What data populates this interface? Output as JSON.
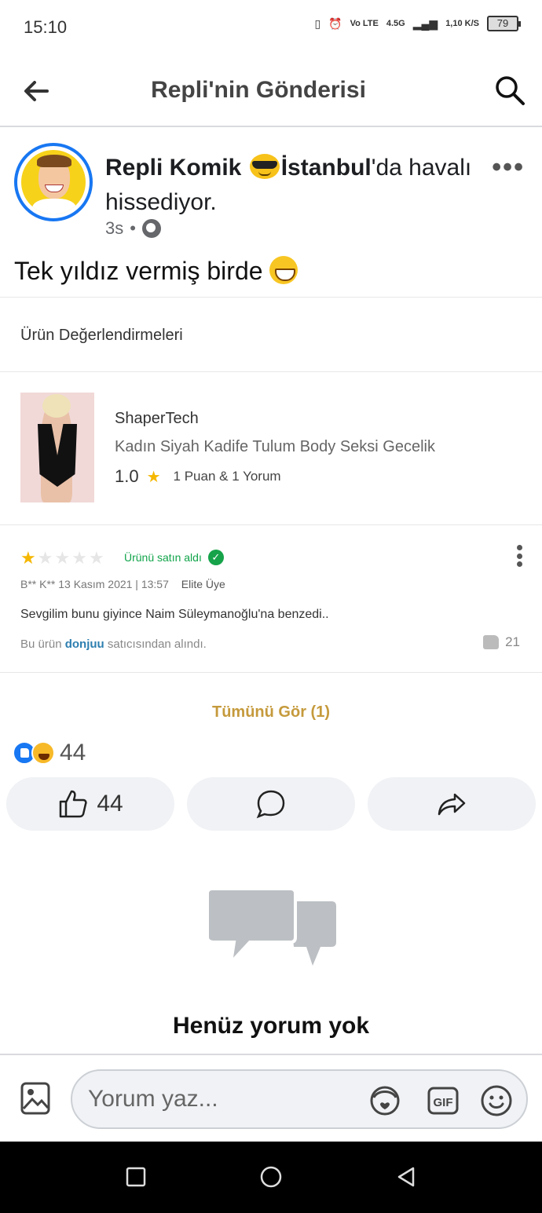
{
  "status_bar": {
    "time": "15:10",
    "network": "4.5G",
    "volte": "Vo LTE",
    "speed": "1,10 K/S",
    "battery": "79"
  },
  "header": {
    "title": "Repli'nin Gönderisi"
  },
  "post": {
    "author": "Repli Komik",
    "location": "İstanbul",
    "feeling_suffix": "'da havalı hissediyor.",
    "time": "3s",
    "separator": "•",
    "text": "Tek yıldız vermiş birde"
  },
  "embedded": {
    "section_title": "Ürün Değerlendirmeleri",
    "brand": "ShaperTech",
    "product_name": "Kadın Siyah Kadife Tulum Body Seksi Gecelik",
    "rating_score": "1.0",
    "rating_summary": "1 Puan & 1 Yorum",
    "review": {
      "stars": 1,
      "max_stars": 5,
      "bought_label": "Ürünü satın aldı",
      "reviewer": "B** K**",
      "date": "13 Kasım 2021 | 13:57",
      "badge": "Elite Üye",
      "text": "Sevgilim bunu giyince Naim Süleymanoğlu'na benzedi..",
      "seller_prefix": "Bu ürün",
      "seller_name": "donjuu",
      "seller_suffix": "satıcısından alındı.",
      "likes": "21"
    },
    "see_all": "Tümünü Gör (1)"
  },
  "reactions": {
    "count": "44"
  },
  "actions": {
    "like_count": "44"
  },
  "comments": {
    "empty_title": "Henüz yorum yok"
  },
  "composer": {
    "placeholder": "Yorum yaz..."
  },
  "colors": {
    "accent": "#1877f2",
    "star": "#f5b700",
    "bought_green": "#16a34a",
    "see_all": "#c59a3c"
  }
}
